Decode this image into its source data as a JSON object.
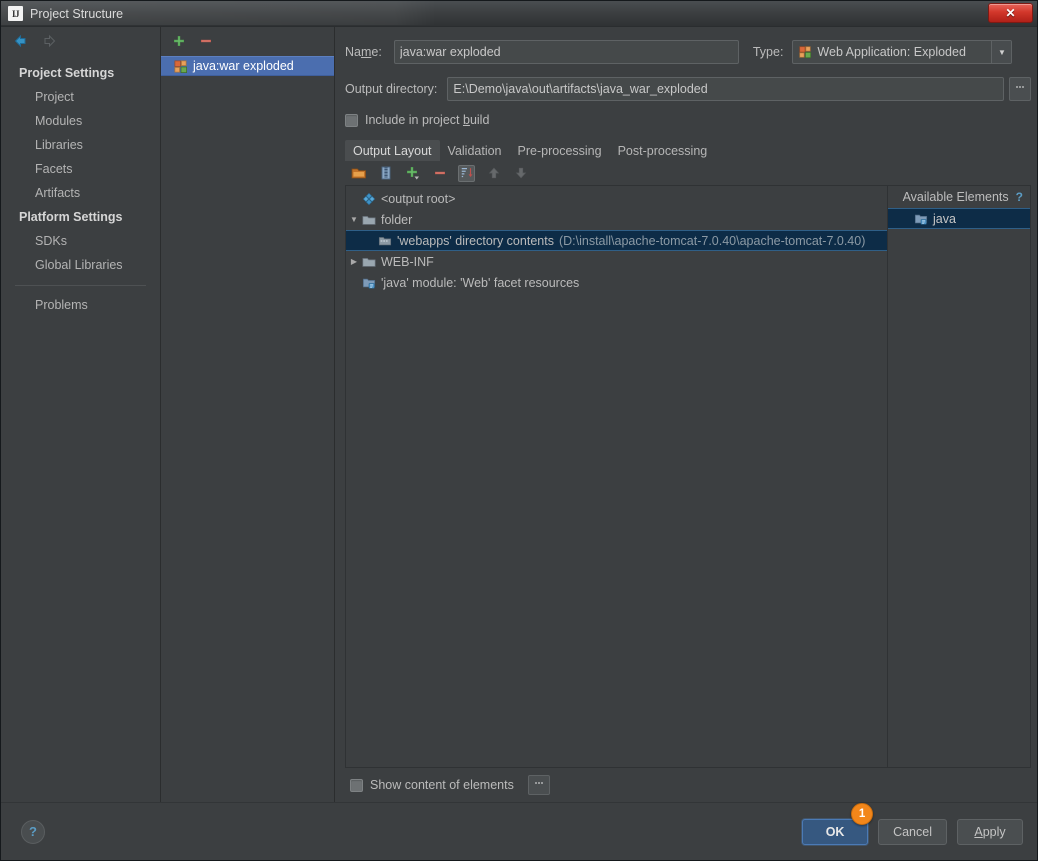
{
  "window": {
    "title": "Project Structure",
    "app_icon": "intellij-idea-icon",
    "close_label": "x"
  },
  "nav": {
    "back_icon": "arrow-left-icon",
    "forward_icon": "arrow-right-icon"
  },
  "sidebar": {
    "groups": [
      {
        "label": "Project Settings",
        "items": [
          {
            "label": "Project"
          },
          {
            "label": "Modules"
          },
          {
            "label": "Libraries"
          },
          {
            "label": "Facets"
          },
          {
            "label": "Artifacts"
          }
        ]
      },
      {
        "label": "Platform Settings",
        "items": [
          {
            "label": "SDKs"
          },
          {
            "label": "Global Libraries"
          }
        ]
      }
    ],
    "problems_label": "Problems"
  },
  "artifacts_panel": {
    "add_icon": "plus-icon",
    "remove_icon": "minus-icon",
    "items": [
      {
        "label": "java:war exploded",
        "icon": "artifact-exploded-icon",
        "selected": true
      }
    ]
  },
  "form": {
    "name_label": "Name:",
    "name_value": "java:war exploded",
    "name_placeholder": "",
    "type_label": "Type:",
    "type_value": "Web Application: Exploded",
    "type_icon": "artifact-exploded-icon",
    "output_dir_label": "Output directory:",
    "output_dir_value": "E:\\Demo\\java\\out\\artifacts\\java_war_exploded",
    "output_dir_placeholder": "",
    "browse_label": "...",
    "include_in_build_label": "Include in project build",
    "include_in_build_checked": false
  },
  "tabs": [
    {
      "label": "Output Layout",
      "active": true
    },
    {
      "label": "Validation",
      "active": false
    },
    {
      "label": "Pre-processing",
      "active": false
    },
    {
      "label": "Post-processing",
      "active": false
    }
  ],
  "tree_toolbar": [
    {
      "name": "create-directory-icon",
      "state": "enabled"
    },
    {
      "name": "create-archive-icon",
      "state": "enabled"
    },
    {
      "name": "add-copy-icon",
      "state": "enabled"
    },
    {
      "name": "remove-icon",
      "state": "enabled"
    },
    {
      "name": "sort-icon",
      "state": "pressed"
    },
    {
      "name": "move-up-icon",
      "state": "disabled"
    },
    {
      "name": "move-down-icon",
      "state": "disabled"
    }
  ],
  "output_tree": [
    {
      "label": "<output root>",
      "icon": "output-root-icon",
      "indent": 0,
      "twisty": "none",
      "selected": false,
      "path": ""
    },
    {
      "label": "folder",
      "icon": "folder-icon",
      "indent": 0,
      "twisty": "expanded",
      "selected": false,
      "path": ""
    },
    {
      "label": "'webapps' directory contents",
      "icon": "directory-contents-icon",
      "indent": 1,
      "twisty": "none",
      "selected": true,
      "path": "(D:\\install\\apache-tomcat-7.0.40\\apache-tomcat-7.0.40)"
    },
    {
      "label": "WEB-INF",
      "icon": "folder-icon",
      "indent": 0,
      "twisty": "collapsed",
      "selected": false,
      "path": ""
    },
    {
      "label": "'java' module: 'Web' facet resources",
      "icon": "module-facet-icon",
      "indent": 0,
      "twisty": "none",
      "selected": false,
      "path": ""
    }
  ],
  "available_elements": {
    "title": "Available Elements",
    "help_icon": "help-icon",
    "help_label": "?",
    "items": [
      {
        "label": "java",
        "icon": "module-facet-icon",
        "selected": true
      }
    ]
  },
  "show_content": {
    "label": "Show content of elements",
    "checked": false,
    "options_label": "..."
  },
  "footer": {
    "help_label": "?",
    "help_icon": "help-icon",
    "ok_label": "OK",
    "ok_badge": "1",
    "cancel_label": "Cancel",
    "apply_label": "Apply",
    "apply_mnemonic": "A"
  },
  "colors": {
    "panel_bg": "#3c3f41",
    "selection_blue": "#4b6eaf",
    "tree_selection": "#0d2c47",
    "default_button": "#365880",
    "badge_orange": "#f2861a",
    "link_blue": "#5b9cc4",
    "path_text": "#8c9aa5"
  }
}
